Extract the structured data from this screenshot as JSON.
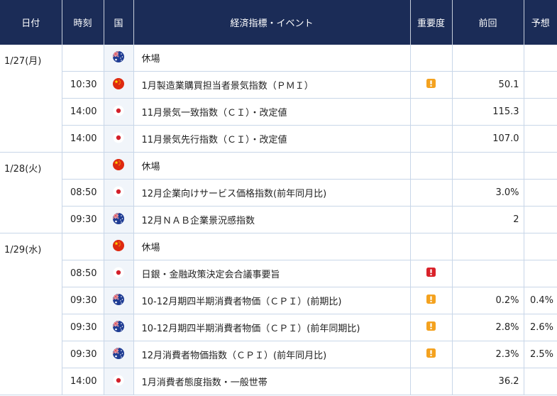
{
  "header": {
    "date": "日付",
    "time": "時刻",
    "country": "国",
    "event": "経済指標・イベント",
    "importance": "重要度",
    "previous": "前回",
    "forecast": "予想"
  },
  "groups": [
    {
      "date": "1/27(月)",
      "rows": [
        {
          "time": "",
          "country": "australia",
          "event": "休場",
          "importance": "",
          "previous": "",
          "forecast": ""
        },
        {
          "time": "10:30",
          "country": "china",
          "event": "1月製造業購買担当者景気指数（ＰＭＩ）",
          "importance": "medium",
          "previous": "50.1",
          "forecast": ""
        },
        {
          "time": "14:00",
          "country": "japan",
          "event": "11月景気一致指数（ＣＩ）・改定値",
          "importance": "",
          "previous": "115.3",
          "forecast": ""
        },
        {
          "time": "14:00",
          "country": "japan",
          "event": "11月景気先行指数（ＣＩ）・改定値",
          "importance": "",
          "previous": "107.0",
          "forecast": ""
        }
      ]
    },
    {
      "date": "1/28(火)",
      "rows": [
        {
          "time": "",
          "country": "china",
          "event": "休場",
          "importance": "",
          "previous": "",
          "forecast": ""
        },
        {
          "time": "08:50",
          "country": "japan",
          "event": "12月企業向けサービス価格指数(前年同月比)",
          "importance": "",
          "previous": "3.0%",
          "forecast": ""
        },
        {
          "time": "09:30",
          "country": "australia",
          "event": "12月ＮＡＢ企業景況感指数",
          "importance": "",
          "previous": "2",
          "forecast": ""
        }
      ]
    },
    {
      "date": "1/29(水)",
      "rows": [
        {
          "time": "",
          "country": "china",
          "event": "休場",
          "importance": "",
          "previous": "",
          "forecast": ""
        },
        {
          "time": "08:50",
          "country": "japan",
          "event": "日銀・金融政策決定会合議事要旨",
          "importance": "high",
          "previous": "",
          "forecast": ""
        },
        {
          "time": "09:30",
          "country": "australia",
          "event": "10-12月期四半期消費者物価（ＣＰＩ）(前期比)",
          "importance": "medium",
          "previous": "0.2%",
          "forecast": "0.4%"
        },
        {
          "time": "09:30",
          "country": "australia",
          "event": "10-12月期四半期消費者物価（ＣＰＩ）(前年同期比)",
          "importance": "medium",
          "previous": "2.8%",
          "forecast": "2.6%"
        },
        {
          "time": "09:30",
          "country": "australia",
          "event": "12月消費者物価指数（ＣＰＩ）(前年同月比)",
          "importance": "medium",
          "previous": "2.3%",
          "forecast": "2.5%"
        },
        {
          "time": "14:00",
          "country": "japan",
          "event": "1月消費者態度指数・一般世帯",
          "importance": "",
          "previous": "36.2",
          "forecast": ""
        }
      ]
    }
  ],
  "colors": {
    "header_bg": "#1b2c57",
    "row_border": "#c8d6e8",
    "importance_medium": "#f4a21f",
    "importance_high": "#d9222a"
  }
}
